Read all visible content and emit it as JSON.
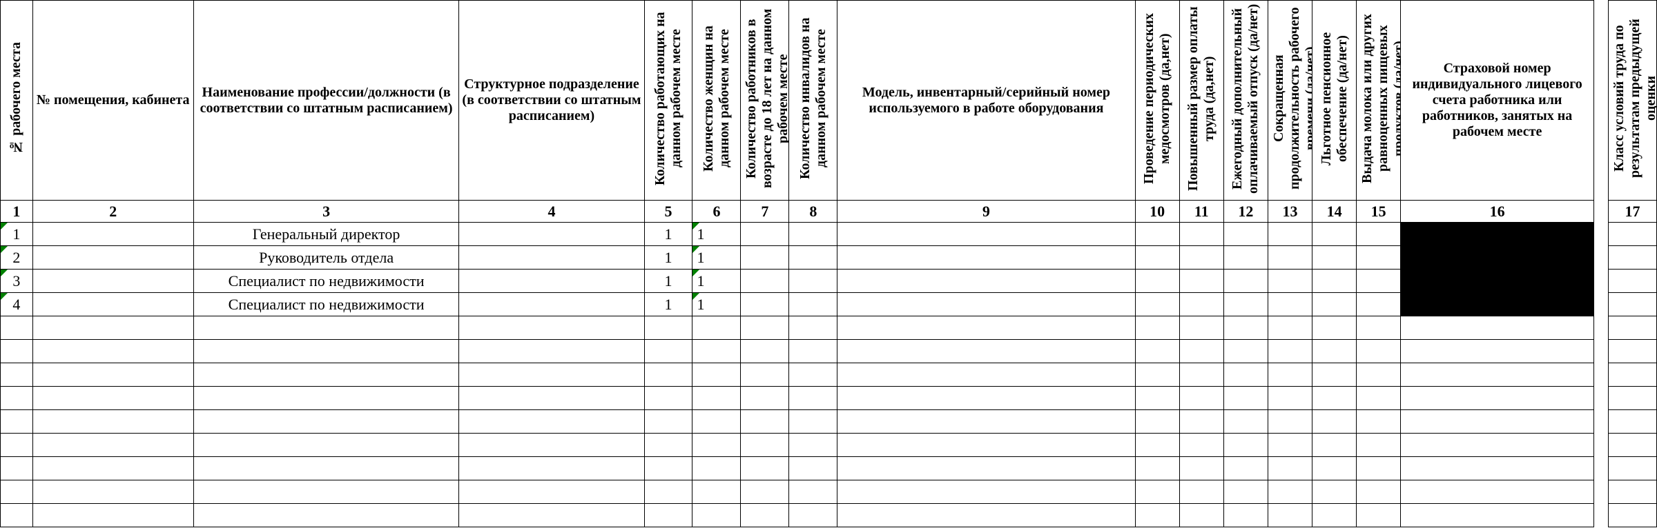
{
  "headers": {
    "c1": "№ рабочего места",
    "c2": "№ помещения, кабинета",
    "c3": "Наименование профессии/должности\n(в соответствии со штатным расписанием)",
    "c4": "Структурное подразделение\n(в соответствии со штатным расписанием)",
    "c5": "Количество работающих на данном рабочем месте",
    "c6": "Количество женщин на данном рабочем месте",
    "c7": "Количество работников в возрасте до 18 лет на данном рабочем месте",
    "c8": "Количество инвалидов на данном рабочем месте",
    "c9": "Модель, инвентарный/серийный номер используемого в работе оборудования",
    "c10": "Проведение периодических медосмотров (да,нет)",
    "c11": "Повышенный размер оплаты труда (да,нет)",
    "c12": "Ежегодный дополнительный оплачиваемый отпуск (да/нет)",
    "c13": "Сокращенная продолжительность рабочего времени (да/нет)",
    "c14": "Льготное пенсионное обеспечение (да/нет)",
    "c15": "Выдача молока или других равноценных пищевых продуктов (да/нет)",
    "c16": "Страховой номер индивидуального лицевого счета работника или работников, занятых на рабочем месте",
    "c17": "Класс условий труда по результатам предыдущей оценки"
  },
  "numrow": [
    "1",
    "2",
    "3",
    "4",
    "5",
    "6",
    "7",
    "8",
    "9",
    "10",
    "11",
    "12",
    "13",
    "14",
    "15",
    "16",
    "",
    "17"
  ],
  "rows": [
    {
      "c1": "1",
      "c2": "",
      "c3": "Генеральный директор",
      "c4": "",
      "c5": "1",
      "c6": "1",
      "c7": "",
      "c8": "",
      "c9": "",
      "c10": "",
      "c11": "",
      "c12": "",
      "c13": "",
      "c14": "",
      "c15": "",
      "c16": "[REDACTED]",
      "c17": ""
    },
    {
      "c1": "2",
      "c2": "",
      "c3": "Руководитель отдела",
      "c4": "",
      "c5": "1",
      "c6": "1",
      "c7": "",
      "c8": "",
      "c9": "",
      "c10": "",
      "c11": "",
      "c12": "",
      "c13": "",
      "c14": "",
      "c15": "",
      "c16": "[REDACTED]",
      "c17": ""
    },
    {
      "c1": "3",
      "c2": "",
      "c3": "Специалист по недвижимости",
      "c4": "",
      "c5": "1",
      "c6": "1",
      "c7": "",
      "c8": "",
      "c9": "",
      "c10": "",
      "c11": "",
      "c12": "",
      "c13": "",
      "c14": "",
      "c15": "",
      "c16": "[REDACTED]",
      "c17": ""
    },
    {
      "c1": "4",
      "c2": "",
      "c3": "Специалист по недвижимости",
      "c4": "",
      "c5": "1",
      "c6": "1",
      "c7": "",
      "c8": "",
      "c9": "",
      "c10": "",
      "c11": "",
      "c12": "",
      "c13": "",
      "c14": "",
      "c15": "",
      "c16": "[REDACTED]",
      "c17": ""
    }
  ],
  "empty_rows": 9
}
